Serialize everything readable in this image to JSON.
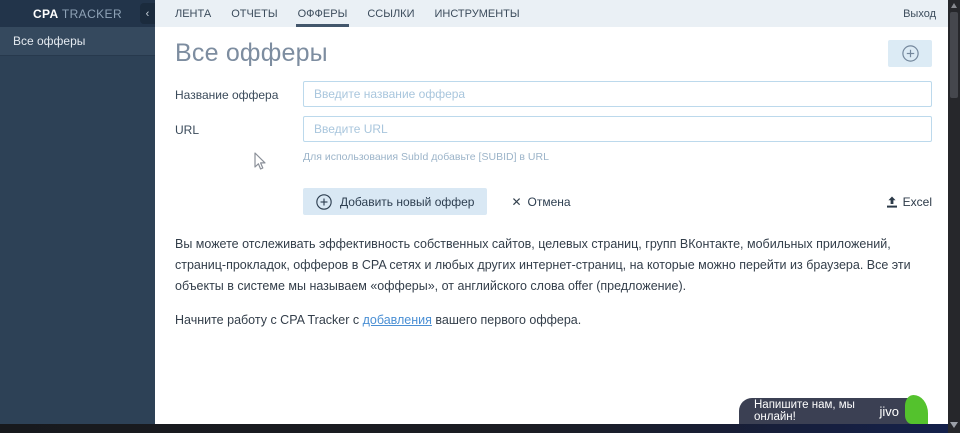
{
  "app": {
    "brand": {
      "bold": "CPA",
      "light": "TRACKER"
    },
    "collapse_icon": "‹",
    "logout": "Выход"
  },
  "sidebar": {
    "items": [
      {
        "label": "Все офферы"
      }
    ]
  },
  "nav": {
    "tabs": [
      {
        "label": "ЛЕНТА"
      },
      {
        "label": "ОТЧЕТЫ"
      },
      {
        "label": "ОФФЕРЫ"
      },
      {
        "label": "ССЫЛКИ"
      },
      {
        "label": "ИНСТРУМЕНТЫ"
      }
    ],
    "active_tab": "ОФФЕРЫ"
  },
  "page": {
    "title": "Все офферы"
  },
  "form": {
    "name": {
      "label": "Название оффера",
      "placeholder": "Введите название оффера",
      "value": ""
    },
    "url": {
      "label": "URL",
      "placeholder": "Введите URL",
      "value": "",
      "hint": "Для использования SubId добавьте [SUBID] в URL"
    },
    "actions": {
      "submit": "Добавить новый оффер",
      "cancel": "Отмена",
      "export": "Excel"
    }
  },
  "content": {
    "intro": "Вы можете отслеживать эффективность собственных сайтов, целевых страниц, групп ВКонтакте, мобильных приложений, страниц-прокладок, офферов в CPA сетях и любых других интернет-страниц, на которые можно перейти из браузера. Все эти объекты в системе мы называем «офферы», от английского слова offer (предложение).",
    "start": {
      "prefix": "Начните работу с CPA Tracker с ",
      "link": "добавления",
      "suffix": " вашего первого оффера."
    }
  },
  "chat": {
    "message": "Напишите нам, мы онлайн!",
    "brand": "jivo"
  },
  "colors": {
    "sidebar_bg": "#2d4156",
    "sidebar_header_bg": "#22344a",
    "topbar_bg": "#eaf0f5",
    "button_bg": "#d9e8f4",
    "input_border": "#bcd9ec",
    "link": "#4a8fd4",
    "title_text": "#7d8da0",
    "chat_bg": "#3b4053",
    "chat_green": "#54c22d"
  }
}
